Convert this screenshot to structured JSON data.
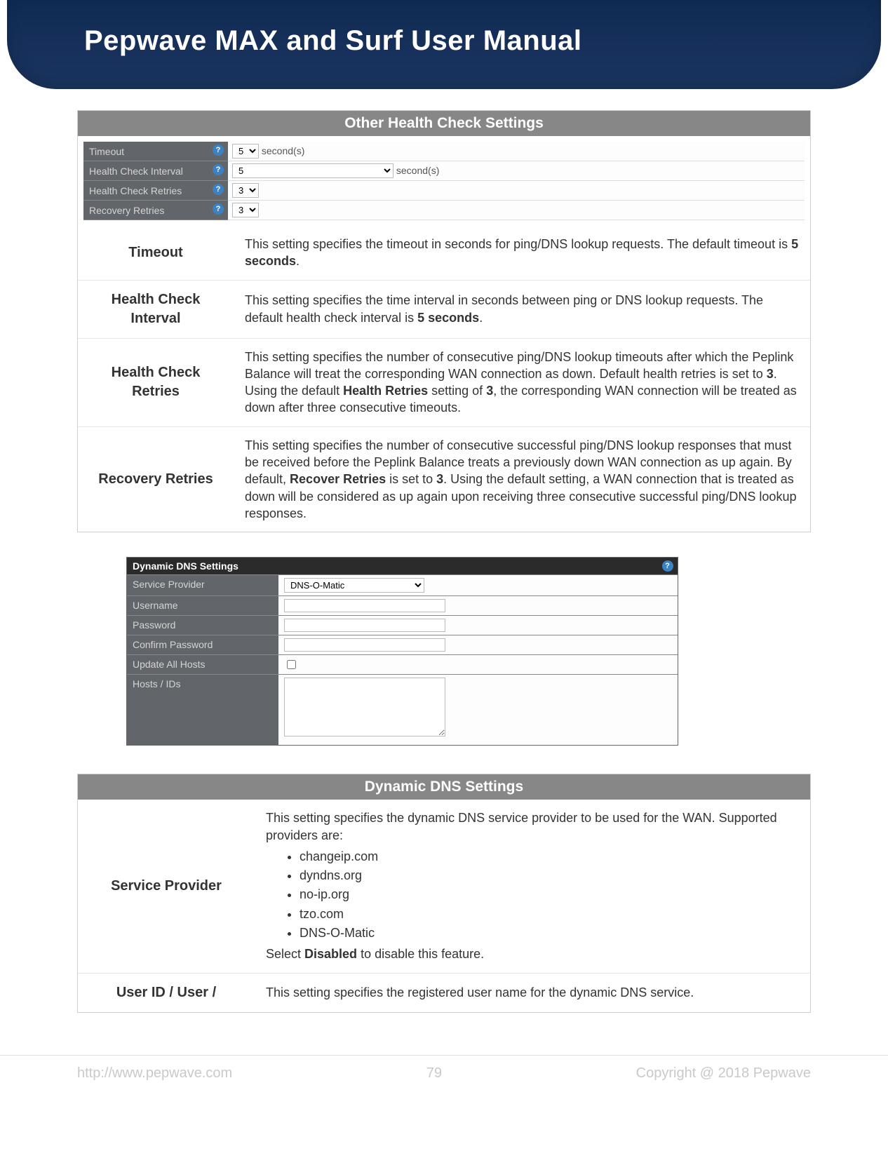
{
  "doc_title": "Pepwave MAX and Surf User Manual",
  "section1": {
    "title": "Other Health Check Settings",
    "shot": {
      "rows": [
        {
          "label": "Timeout",
          "val": "5",
          "unit": "second(s)"
        },
        {
          "label": "Health Check Interval",
          "val": "5",
          "unit": "second(s)",
          "wide": true
        },
        {
          "label": "Health Check Retries",
          "val": "3"
        },
        {
          "label": "Recovery Retries",
          "val": "3"
        }
      ]
    },
    "defs": [
      {
        "k": "Timeout",
        "v_pre": "This setting specifies the timeout in seconds for ping/DNS lookup requests. The default timeout is ",
        "v_bold": "5 seconds",
        "v_post": "."
      },
      {
        "k": "Health Check Interval",
        "v_pre": "This setting specifies the time interval in seconds between ping or DNS lookup requests. The default health check interval is ",
        "v_bold": "5 seconds",
        "v_post": "."
      },
      {
        "k": "Health Check Retries",
        "v_full": "This setting specifies the number of consecutive ping/DNS lookup timeouts after which the Peplink Balance will treat the corresponding WAN connection as down. Default health retries is set to ",
        "b1": "3",
        "mid": ". Using the default ",
        "b2": "Health Retries",
        "mid2": " setting of ",
        "b3": "3",
        "post": ", the corresponding WAN connection will be treated as down after three consecutive timeouts."
      },
      {
        "k": "Recovery Retries",
        "v_full": "This setting specifies the number of consecutive successful ping/DNS lookup responses that must be received before the Peplink Balance treats a previously down WAN connection as up again. By default, ",
        "b1": "Recover Retries",
        "mid": " is set to ",
        "b2": "3",
        "post": ". Using the default setting, a WAN connection that is treated as down will be considered as up again upon receiving three consecutive successful ping/DNS lookup responses."
      }
    ]
  },
  "ddns_shot": {
    "title": "Dynamic DNS Settings",
    "rows": [
      {
        "l": "Service Provider",
        "r_select": "DNS-O-Matic"
      },
      {
        "l": "Username"
      },
      {
        "l": "Password"
      },
      {
        "l": "Confirm Password"
      },
      {
        "l": "Update All Hosts",
        "r_chk": true
      },
      {
        "l": "Hosts / IDs",
        "r_textarea": true
      }
    ]
  },
  "section2": {
    "title": "Dynamic DNS Settings",
    "sp": {
      "k": "Service Provider",
      "intro": "This setting specifies the dynamic DNS service provider to be used for the WAN. Supported providers are:",
      "items": [
        "changeip.com",
        "dyndns.org",
        "no-ip.org",
        "tzo.com",
        "DNS-O-Matic"
      ],
      "outro_pre": "Select ",
      "outro_b": "Disabled",
      "outro_post": " to disable this feature."
    },
    "user": {
      "k": "User ID / User /",
      "v": "This setting specifies the registered user name for the dynamic DNS service."
    }
  },
  "footer": {
    "url": "http://www.pepwave.com",
    "page": "79",
    "copy": "Copyright @ 2018 Pepwave"
  }
}
